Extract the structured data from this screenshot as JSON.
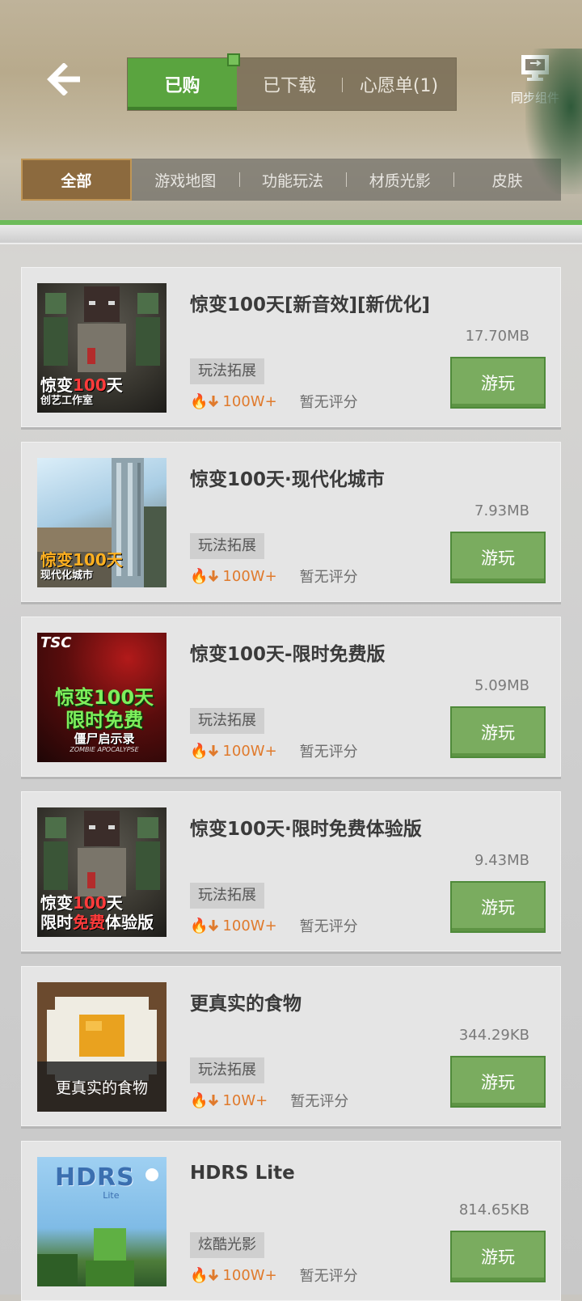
{
  "header": {
    "tabs": [
      {
        "label": "已购",
        "active": true
      },
      {
        "label": "已下载",
        "active": false
      },
      {
        "label": "心愿单(1)",
        "active": false
      }
    ],
    "sync_label": "同步组件",
    "sub_tabs": [
      {
        "label": "全部",
        "active": true
      },
      {
        "label": "游戏地图",
        "active": false
      },
      {
        "label": "功能玩法",
        "active": false
      },
      {
        "label": "材质光影",
        "active": false
      },
      {
        "label": "皮肤",
        "active": false
      }
    ]
  },
  "items": [
    {
      "title": "惊变100天[新音效][新优化]",
      "size": "17.70MB",
      "tag": "玩法拓展",
      "downloads": "100W+",
      "rating": "暂无评分",
      "play": "游玩",
      "thumb_line1": [
        "惊变",
        "100",
        "天"
      ],
      "thumb_line2": "创艺工作室"
    },
    {
      "title": "惊变100天·现代化城市",
      "size": "7.93MB",
      "tag": "玩法拓展",
      "downloads": "100W+",
      "rating": "暂无评分",
      "play": "游玩",
      "thumb_line1": "惊变100天",
      "thumb_line2": "现代化城市"
    },
    {
      "title": "惊变100天-限时免费版",
      "size": "5.09MB",
      "tag": "玩法拓展",
      "downloads": "100W+",
      "rating": "暂无评分",
      "play": "游玩",
      "thumb_top": "TSC",
      "thumb_line1": "惊变100天",
      "thumb_line2": "限时免费",
      "thumb_line3": "僵尸启示录",
      "thumb_line4": "ZOMBIE APOCALYPSE"
    },
    {
      "title": "惊变100天·限时免费体验版",
      "size": "9.43MB",
      "tag": "玩法拓展",
      "downloads": "100W+",
      "rating": "暂无评分",
      "play": "游玩",
      "thumb_line1": [
        "惊变",
        "100",
        "天"
      ],
      "thumb_line2": [
        "限时",
        "免费",
        "体验版"
      ]
    },
    {
      "title": "更真实的食物",
      "size": "344.29KB",
      "tag": "玩法拓展",
      "downloads": "10W+",
      "rating": "暂无评分",
      "play": "游玩",
      "thumb_line1": "更真实的食物"
    },
    {
      "title": "HDRS Lite",
      "size": "814.65KB",
      "tag": "炫酷光影",
      "downloads": "100W+",
      "rating": "暂无评分",
      "play": "游玩",
      "thumb_line1": "HDRS",
      "thumb_line2": "Lite"
    }
  ],
  "colors": {
    "accent_green": "#7aac5f",
    "tab_active": "#5aa43f",
    "subtab_active": "#8c6a3e",
    "downloads": "#e07a2c"
  }
}
